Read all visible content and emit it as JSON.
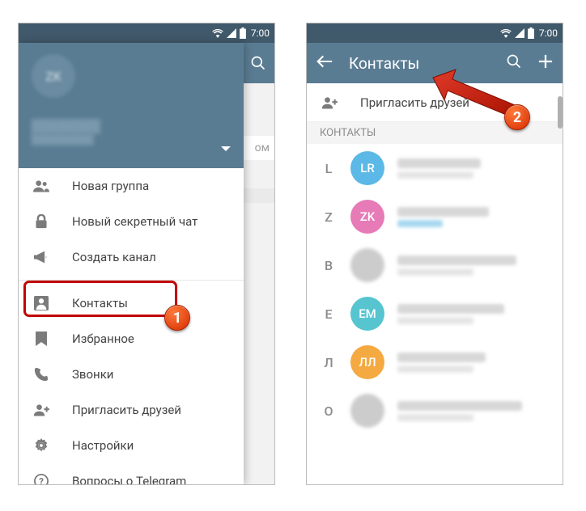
{
  "statusbar": {
    "time": "7:00"
  },
  "left": {
    "drawer": {
      "profile": {
        "initials": "ZK",
        "name": "████████",
        "phone": "█████████"
      },
      "menu1": [
        {
          "icon": "group",
          "label": "Новая группа"
        },
        {
          "icon": "lock",
          "label": "Новый секретный чат"
        },
        {
          "icon": "megaphone",
          "label": "Создать канал"
        }
      ],
      "menu2": [
        {
          "icon": "contact",
          "label": "Контакты"
        },
        {
          "icon": "bookmark",
          "label": "Избранное"
        },
        {
          "icon": "phone",
          "label": "Звонки"
        },
        {
          "icon": "adduser",
          "label": "Пригласить друзей"
        },
        {
          "icon": "gear",
          "label": "Настройки"
        },
        {
          "icon": "help",
          "label": "Вопросы о Telegram"
        }
      ]
    },
    "bg_text": "ом"
  },
  "right": {
    "appbar": {
      "title": "Контакты"
    },
    "invite_label": "Пригласить друзей",
    "section_label": "КОНТАКТЫ",
    "contacts": [
      {
        "letter": "L",
        "avatar_text": "LR",
        "avatar_color": "#5cb8e6",
        "name_w": 55,
        "online": false
      },
      {
        "letter": "Z",
        "avatar_text": "ZK",
        "avatar_color": "#e77bb8",
        "name_w": 60,
        "online": true
      },
      {
        "letter": "В",
        "avatar_text": "",
        "avatar_img": true,
        "name_w": 78,
        "online": false
      },
      {
        "letter": "Е",
        "avatar_text": "ЕМ",
        "avatar_color": "#56c5d0",
        "name_w": 70,
        "online": false
      },
      {
        "letter": "Л",
        "avatar_text": "ЛЛ",
        "avatar_color": "#f4a941",
        "name_w": 58,
        "online": false
      },
      {
        "letter": "О",
        "avatar_text": "",
        "avatar_img": true,
        "name_w": 82,
        "online": false
      }
    ]
  },
  "steps": {
    "one": "1",
    "two": "2"
  }
}
